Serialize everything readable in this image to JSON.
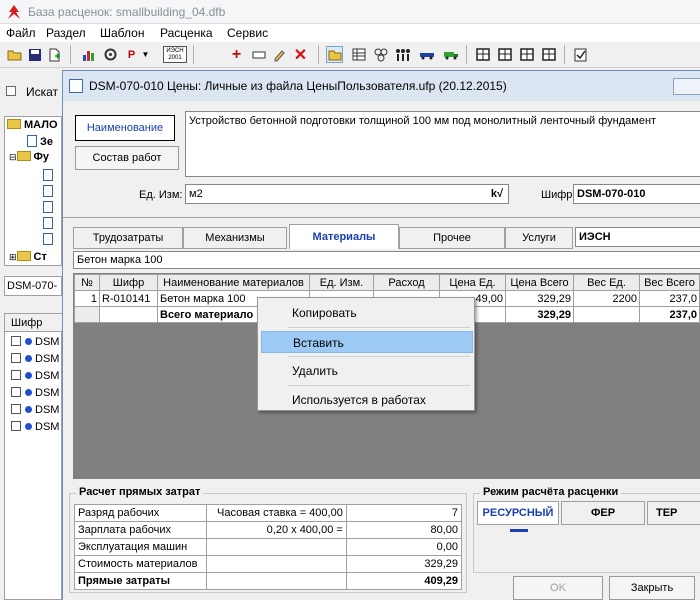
{
  "app": {
    "title": "База расценок:  smallbuilding_04.dfb"
  },
  "menu": [
    "Файл",
    "Раздел",
    "Шаблон",
    "Расценка",
    "Сервис"
  ],
  "toolbar": {
    "icon_p": "P",
    "icon_iesn": "ИЭСН 2001"
  },
  "left": {
    "search_label": "Искат",
    "tree": [
      {
        "label": "МАЛО"
      },
      {
        "label": "Зе"
      },
      {
        "label": "Фу"
      },
      {
        "label": ""
      },
      {
        "label": ""
      },
      {
        "label": ""
      },
      {
        "label": ""
      },
      {
        "label": ""
      },
      {
        "label": "Ст"
      }
    ],
    "code_field": "DSM-070-",
    "list_header": "Шифр",
    "list_items": [
      "DSM",
      "DSM",
      "DSM",
      "DSM",
      "DSM",
      "DSM"
    ]
  },
  "dialog": {
    "title": "DSM-070-010  Цены: Личные из файла ЦеныПользователя.ufp (20.12.2015)",
    "btn_name": "Наименование",
    "btn_work": "Состав работ",
    "description": "Устройство бетонной подготовки толщиной 100 мм под монолитный ленточный фундамент",
    "unit_label": "Ед. Изм:",
    "unit_value": "м2",
    "unit_btn": "k√",
    "code_label": "Шифр:",
    "code_value": "DSM-070-010",
    "tabs": [
      "Трудозатраты",
      "Механизмы",
      "Материалы",
      "Прочее",
      "Услуги"
    ],
    "tab_combo": "ИЭСН",
    "selected_material": "Бетон марка 100",
    "table": {
      "headers": [
        "№",
        "Шифр",
        "Наименование материалов",
        "Ед. Изм.",
        "Расход",
        "Цена Ед.",
        "Цена Всего",
        "Вес Ед.",
        "Вес Всего"
      ],
      "rows": [
        [
          "1",
          "R-010141",
          "Бетон марка 100",
          "",
          "",
          "49,00",
          "329,29",
          "2200",
          "237,0"
        ],
        [
          "",
          "",
          "Всего материало",
          "",
          "",
          "",
          "329,29",
          "",
          "237,0"
        ]
      ]
    },
    "context_menu": [
      "Копировать",
      "Вставить",
      "Удалить",
      "Используется в работах"
    ],
    "calc": {
      "title": "Расчет прямых затрат",
      "rows": [
        {
          "label": "Разряд рабочих",
          "mid": "Часовая ставка = 400,00",
          "val": "7"
        },
        {
          "label": "Зарплата рабочих",
          "mid": "0,20 x 400,00 =",
          "val": "80,00"
        },
        {
          "label": "Эксплуатация машин",
          "mid": "",
          "val": "0,00"
        },
        {
          "label": "Стоимость материалов",
          "mid": "",
          "val": "329,29"
        },
        {
          "label": "Прямые затраты",
          "mid": "",
          "val": "409,29"
        }
      ]
    },
    "mode": {
      "title": "Режим расчёта расценки",
      "tabs": [
        "РЕСУРСНЫЙ",
        "ФЕР",
        "ТЕР"
      ]
    },
    "ok": "OK",
    "close": "Закрыть"
  },
  "colors": {
    "accent": "#1a40b0",
    "highlight": "#9ccaf5",
    "grid_bg": "#808080"
  }
}
